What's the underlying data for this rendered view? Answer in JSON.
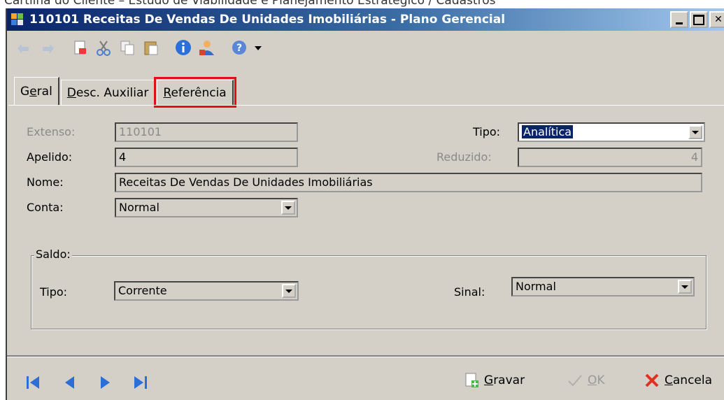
{
  "caption": "Cartilha do Cliente – Estudo de Viabilidade e Planejamento Estratégico / Cadastros",
  "window": {
    "title": "110101 Receitas De Vendas De Unidades Imobiliárias - Plano Gerencial"
  },
  "toolbar": {
    "icons": [
      "undo-icon",
      "redo-icon",
      "new-icon",
      "cut-icon",
      "copy-icon",
      "paste-icon",
      "info-icon",
      "user-icon",
      "help-icon",
      "dropdown-icon"
    ]
  },
  "tabs": [
    {
      "label_pre": "G",
      "label_u": "e",
      "label_post": "ral"
    },
    {
      "label_pre": "",
      "label_u": "D",
      "label_post": "esc. Auxiliar"
    },
    {
      "label_pre": "",
      "label_u": "R",
      "label_post": "eferência"
    }
  ],
  "form": {
    "extenso_label": "Extenso:",
    "extenso_value": "110101",
    "tipo_label": "Tipo:",
    "tipo_value": "Analítica",
    "apelido_label": "Apelido:",
    "apelido_value": "4",
    "reduzido_label": "Reduzido:",
    "reduzido_value": "4",
    "nome_label": "Nome:",
    "nome_value": "Receitas De Vendas De Unidades Imobiliárias",
    "conta_label": "Conta:",
    "conta_value": "Normal"
  },
  "saldo": {
    "group_title": "Saldo:",
    "tipo_label": "Tipo:",
    "tipo_value": "Corrente",
    "sinal_label": "Sinal:",
    "sinal_value": "Normal"
  },
  "bottom": {
    "gravar_pre": "",
    "gravar_u": "G",
    "gravar_post": "ravar",
    "ok_pre": "",
    "ok_u": "O",
    "ok_post": "K",
    "cancela_pre": "",
    "cancela_u": "C",
    "cancela_post": "ancela"
  },
  "colors": {
    "highlight_box": "#e0101a",
    "title_bar": "#0a246a",
    "nav_arrows": "#2b6fd6"
  }
}
